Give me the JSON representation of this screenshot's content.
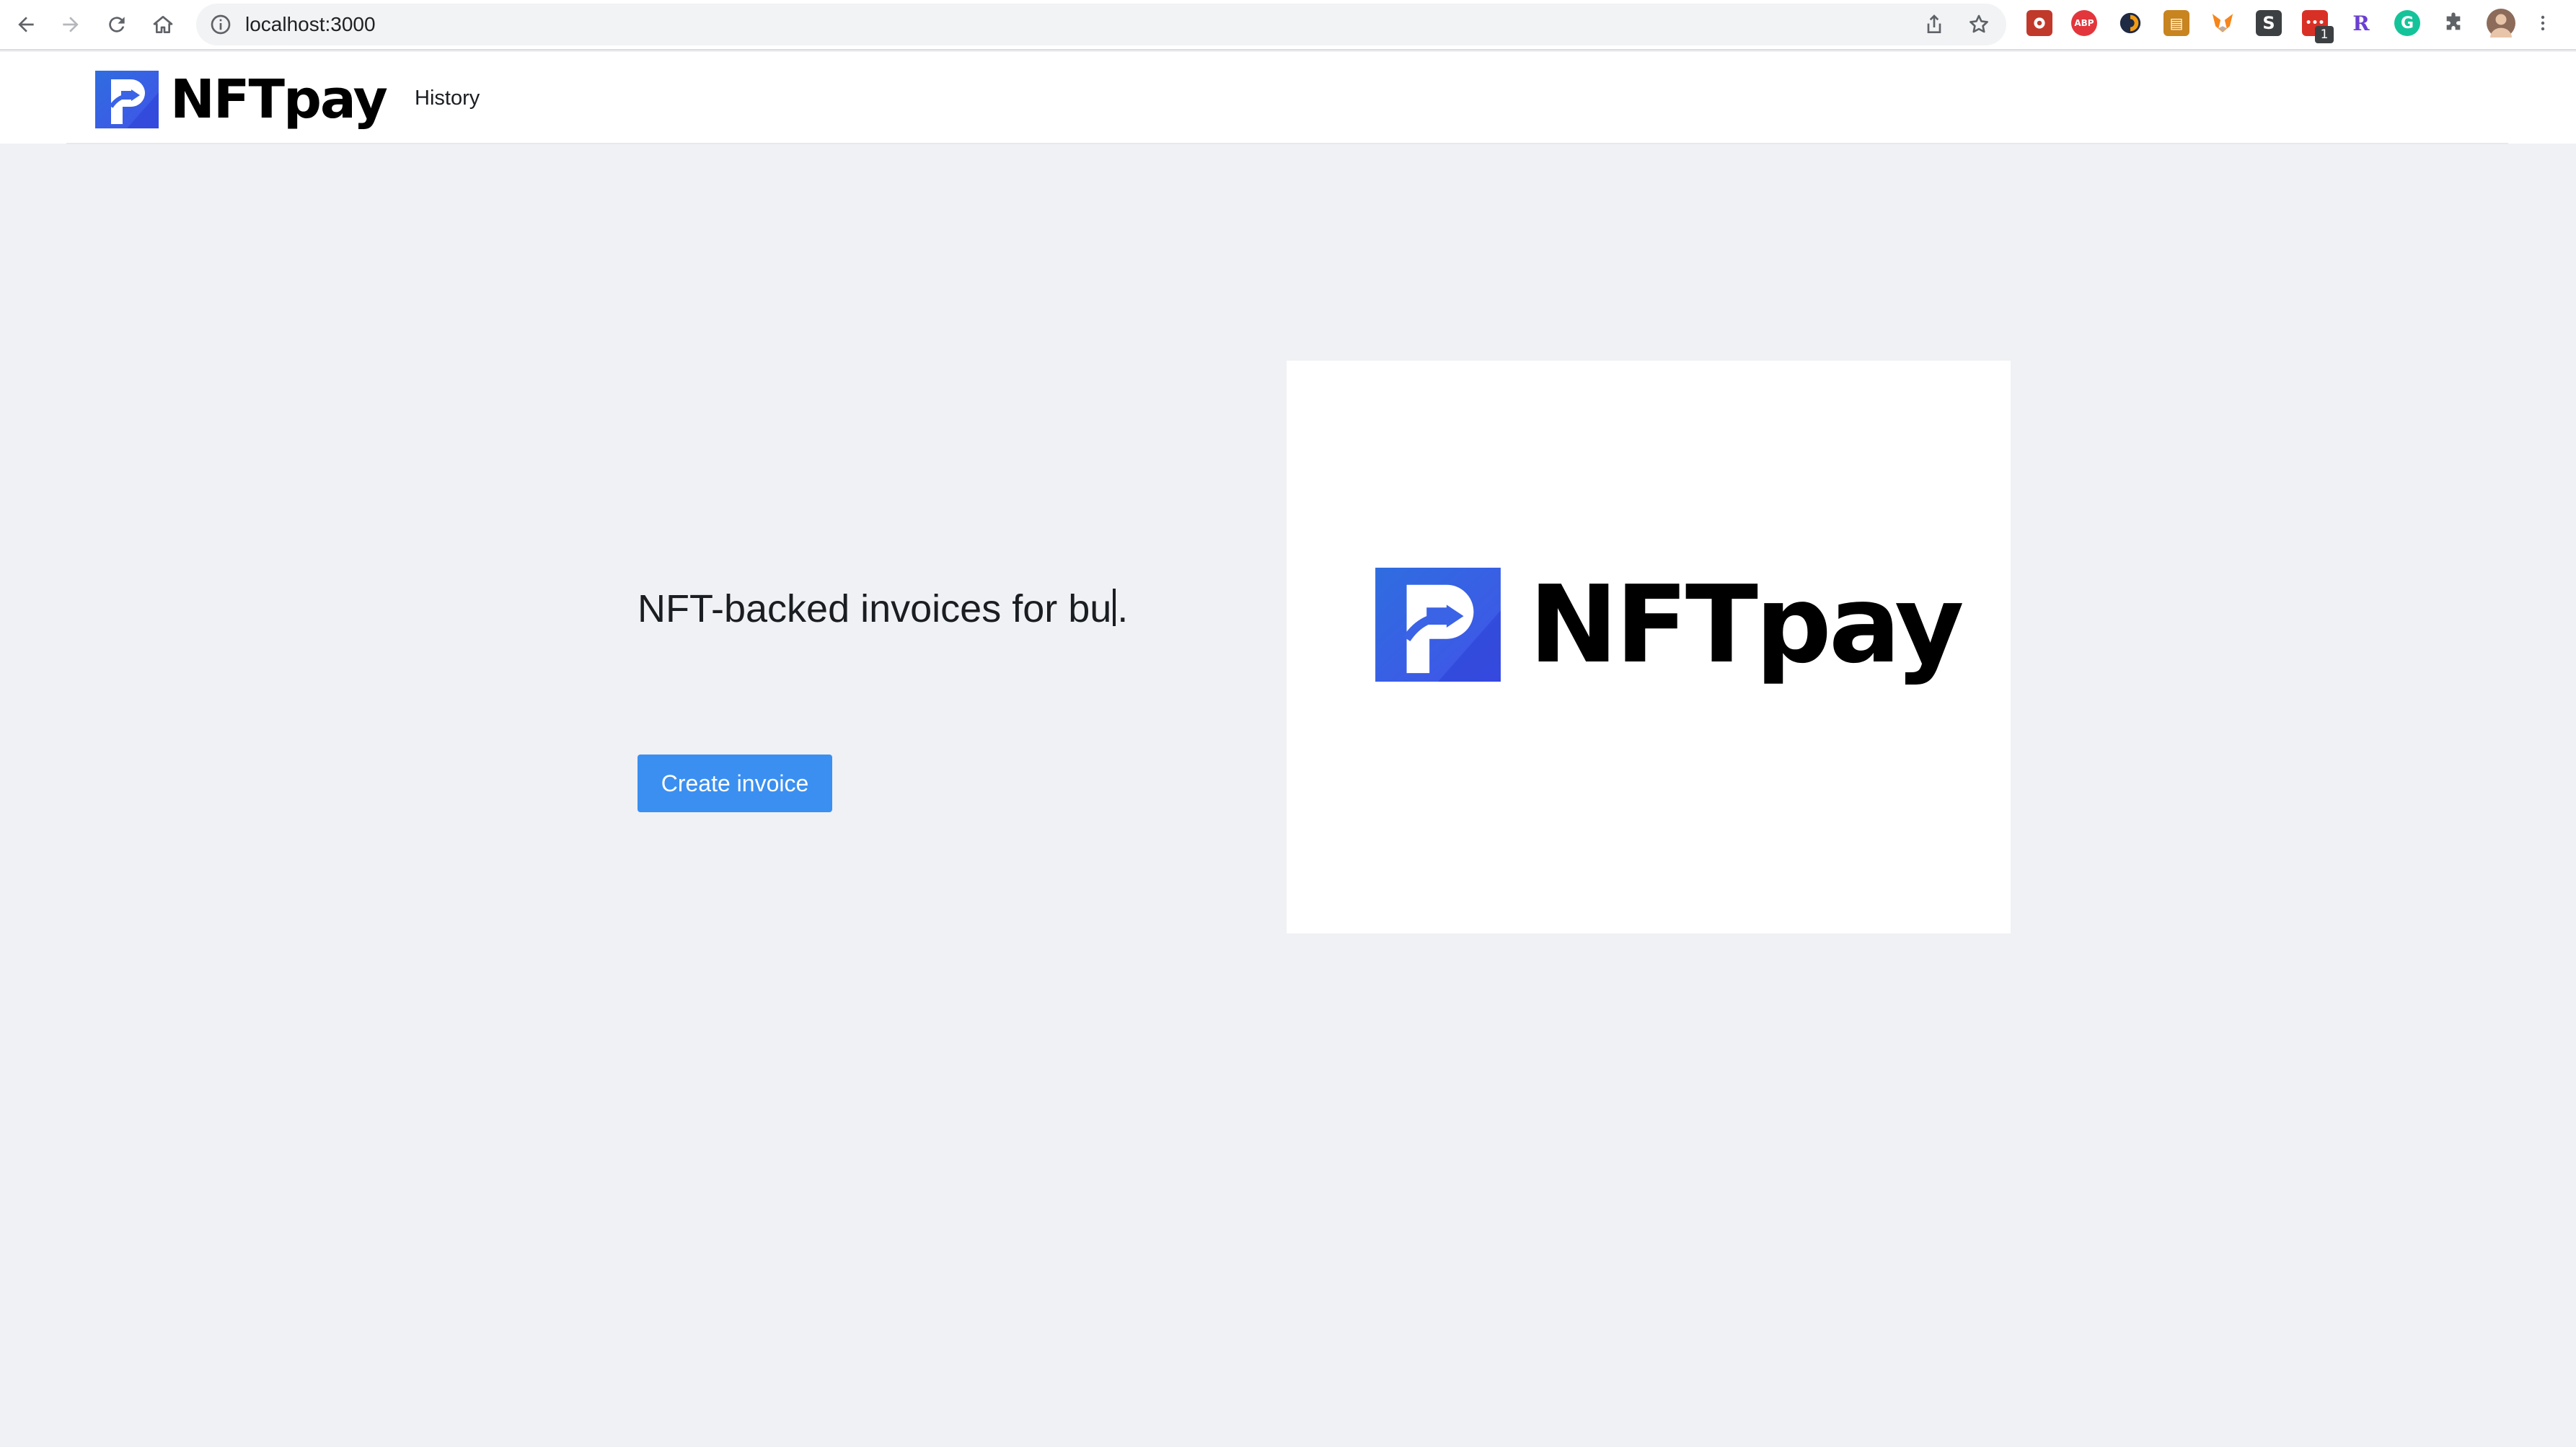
{
  "browser": {
    "url": "localhost:3000",
    "extension_icons": [
      "adblock-plus-icon",
      "metamask-icon",
      "grammarly-icon",
      "puzzle-extensions-icon"
    ],
    "extension_badge": "1"
  },
  "header": {
    "brand_name": "NFTpay",
    "nav": {
      "history_label": "History"
    }
  },
  "hero": {
    "tagline_before_cursor": "NFT-backed invoices for bu",
    "tagline_after_cursor": ".",
    "cta_label": "Create invoice",
    "image_brand_name": "NFTpay"
  },
  "colors": {
    "page_bg": "#f0f1f4",
    "accent": "#3b8ff0",
    "brand_blue": "#3b63e6",
    "text": "#1a1d21"
  }
}
